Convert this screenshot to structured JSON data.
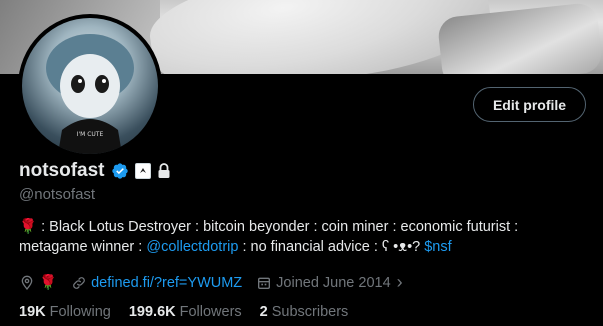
{
  "profile": {
    "display_name": "notsofast",
    "handle": "@notsofast",
    "edit_button_label": "Edit profile",
    "bio": {
      "emoji_rose": "🌹",
      "text_1": " : Black Lotus Destroyer : bitcoin beyonder : coin miner : economic futurist :",
      "text_2": "metagame winner : ",
      "mention": "@collectdotrip",
      "text_3": " : no financial advice : ʕ •ᴥ•? ",
      "cashtag": "$nsf"
    },
    "meta": {
      "location_emoji": "🌹",
      "website": "defined.fi/?ref=YWUMZ",
      "joined": "Joined June 2014",
      "arrow": "›"
    },
    "stats": {
      "following_count": "19K",
      "following_label": "Following",
      "followers_count": "199.6K",
      "followers_label": "Followers",
      "subscribers_count": "2",
      "subscribers_label": "Subscribers"
    }
  },
  "colors": {
    "background": "#000000",
    "text_primary": "#e7e9ea",
    "text_secondary": "#71767b",
    "link": "#1d9bf0",
    "verified": "#1d9bf0",
    "button_border": "#536471"
  }
}
